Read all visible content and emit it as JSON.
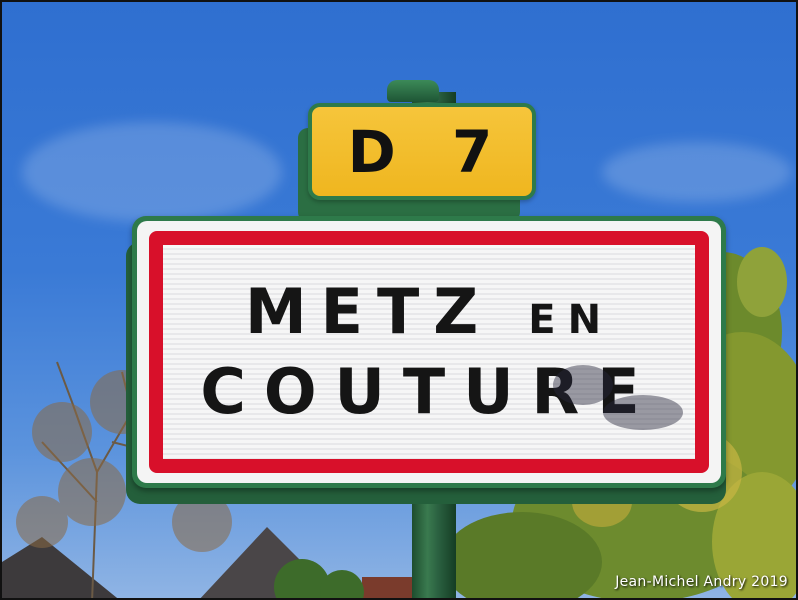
{
  "route_plate": {
    "text": "D 7",
    "color": "#f2bb25"
  },
  "town_sign": {
    "line1_main": "METZ",
    "line1_small": "EN",
    "line2": "COUTURE",
    "border_color": "#d8102a"
  },
  "photo_credit": "Jean-Michel Andry 2019"
}
